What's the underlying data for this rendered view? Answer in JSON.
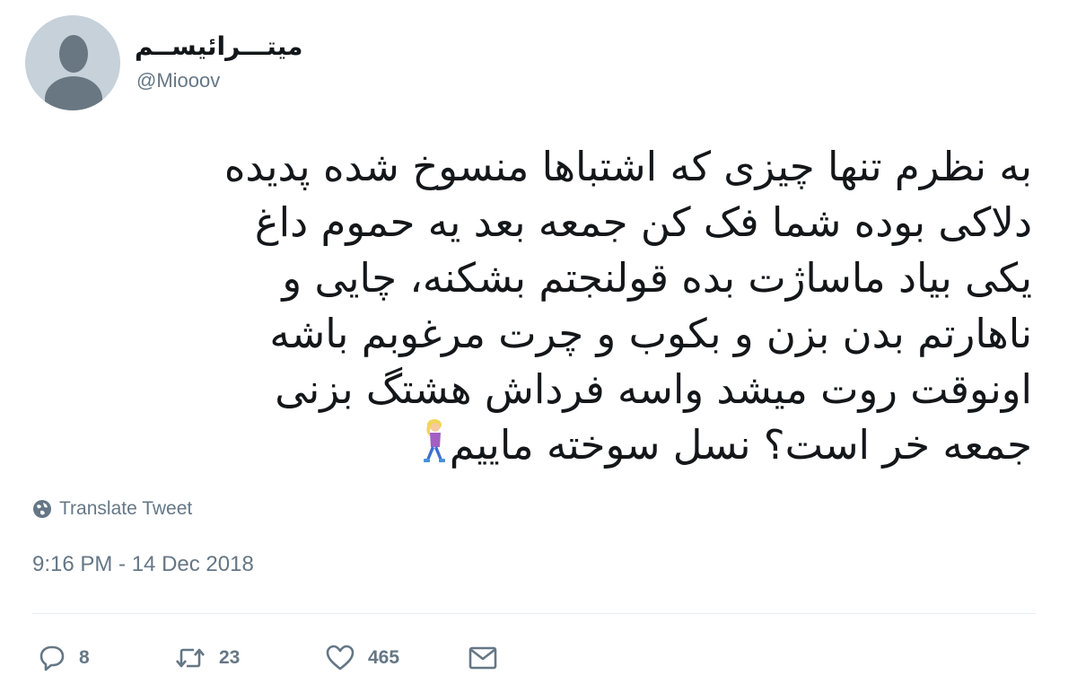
{
  "user": {
    "display_name": "میتـــرائیســم",
    "handle": "@Miooov",
    "avatar_icon": "default-avatar-icon"
  },
  "tweet": {
    "lines": [
      "به نظرم تنها چیزی که اشتباها منسوخ شده پدیده",
      "دلاکی بوده شما فک کن جمعه بعد یه حموم داغ",
      "یکی بیاد ماساژت بده قولنجتم بشکنه، چایی و",
      "ناهارتم بدن بزن و بکوب و چرت مرغوبم باشه",
      "اونوقت روت میشد واسه فرداش هشتگ بزنی",
      "جمعه خر است؟ نسل سوخته ماییم"
    ],
    "emoji": "woman-walking-emoji",
    "translate_label": "Translate Tweet",
    "timestamp": "9:16 PM - 14 Dec 2018"
  },
  "actions": {
    "reply_count": "8",
    "retweet_count": "23",
    "like_count": "465"
  },
  "colors": {
    "text": "#14171a",
    "secondary": "#657786",
    "avatar_bg": "#c6d1da",
    "divider": "#e6ecf0"
  }
}
